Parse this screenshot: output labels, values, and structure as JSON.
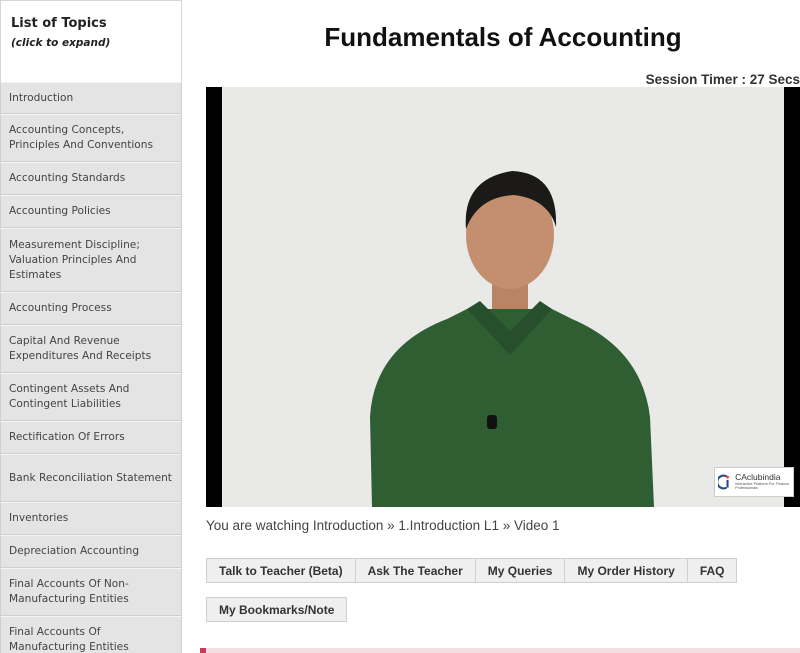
{
  "sidebar": {
    "title": "List of Topics",
    "subtitle": "(click to expand)",
    "topics": [
      "Introduction",
      "Accounting Concepts, Principles And Conventions",
      "Accounting Standards",
      "Accounting Policies",
      "Measurement Discipline; Valuation Principles And Estimates",
      "Accounting Process",
      "Capital And Revenue Expenditures And Receipts",
      "Contingent Assets And Contingent Liabilities",
      "Rectification Of Errors",
      "Bank Reconciliation Statement",
      "Inventories",
      "Depreciation Accounting",
      "Final Accounts Of Non-Manufacturing Entities",
      "Final Accounts Of Manufacturing Entities"
    ]
  },
  "main": {
    "title": "Fundamentals of Accounting",
    "session_timer": "Session Timer : 27 Secs",
    "video": {
      "logo_name": "CAclubindia",
      "logo_tagline": "Interactive Platform For Finance Professionals"
    },
    "watching": "You are watching Introduction » 1.Introduction L1 » Video 1",
    "buttons_row1": [
      "Talk to Teacher (Beta)",
      "Ask The Teacher",
      "My Queries",
      "My Order History",
      "FAQ"
    ],
    "buttons_row2": [
      "My Bookmarks/Note"
    ]
  },
  "colors": {
    "sidebar_bg": "#e4e4e4",
    "shirt_green": "#2f5e33",
    "accent_pink": "#c73b5a"
  }
}
